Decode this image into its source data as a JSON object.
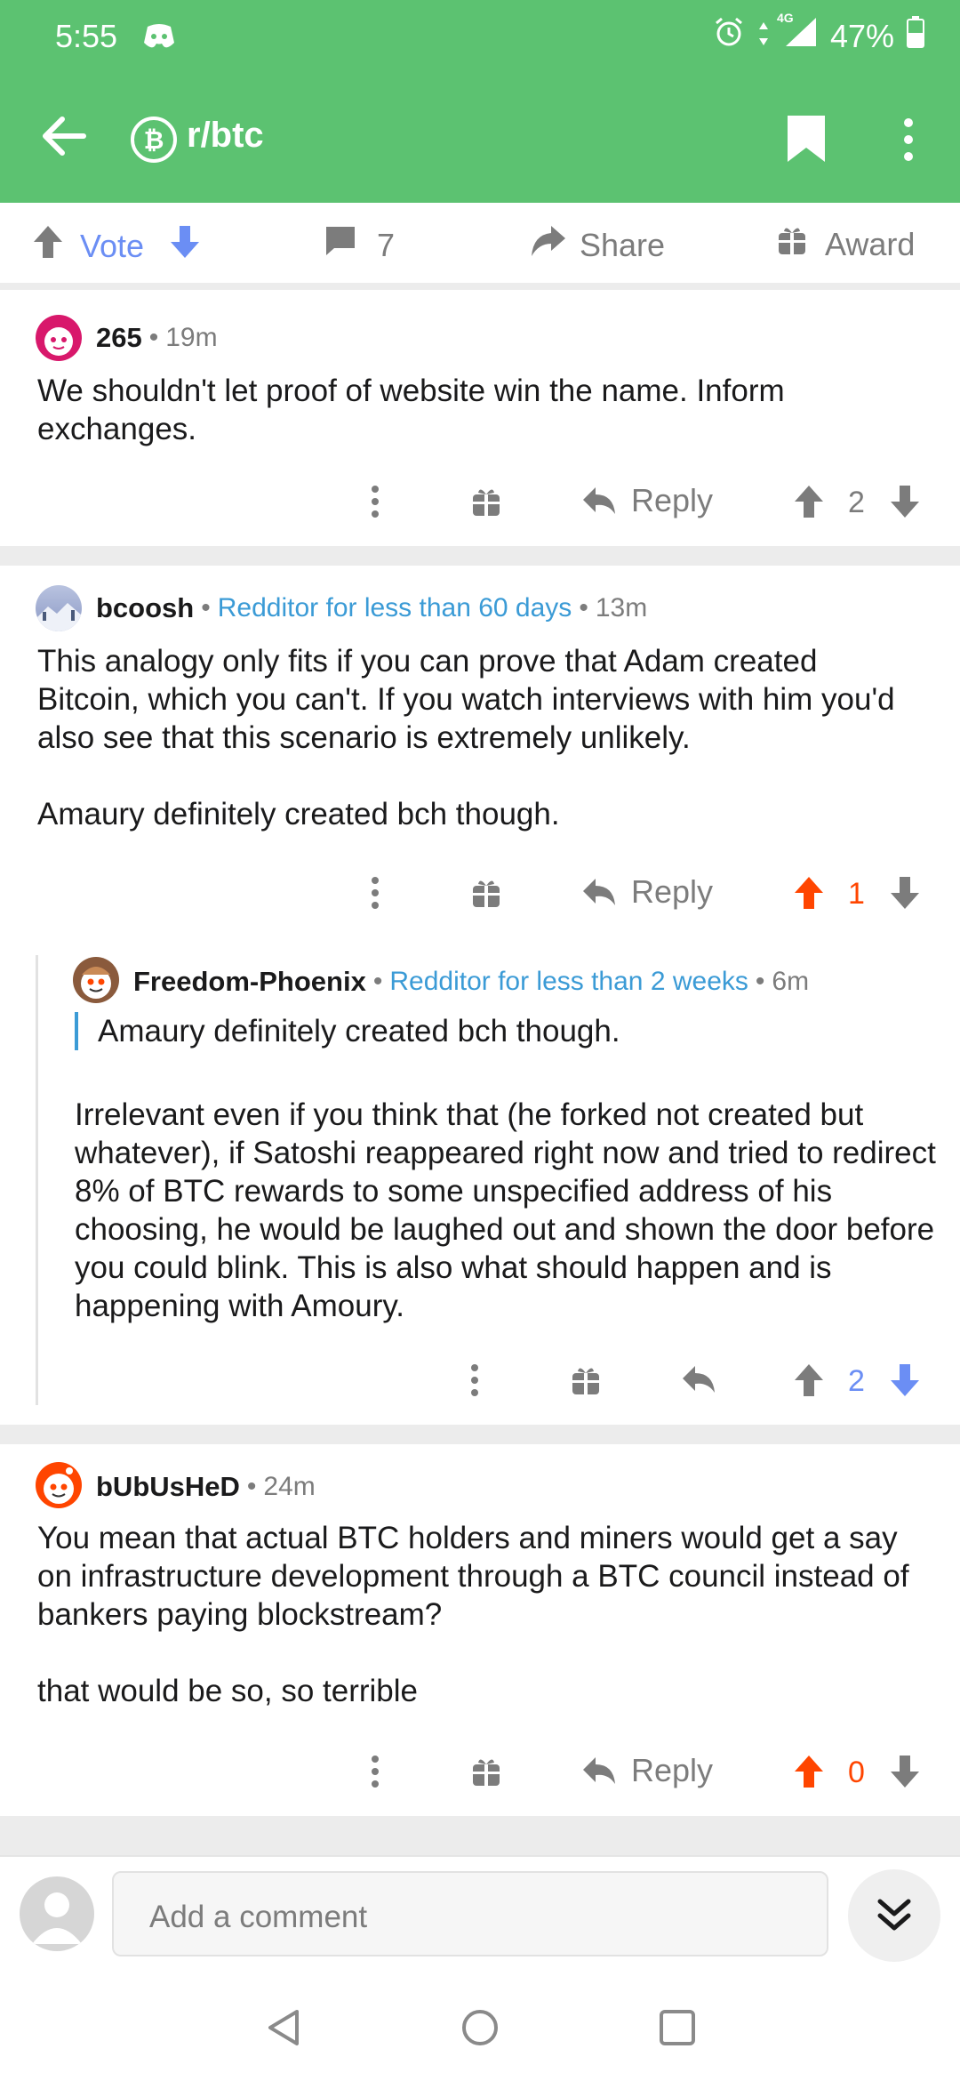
{
  "status_bar": {
    "time": "5:55",
    "network": "4G",
    "battery": "47%"
  },
  "header": {
    "subreddit": "r/btc",
    "accent": "#5cc271"
  },
  "post_actions": {
    "vote_label": "Vote",
    "comments_count": "7",
    "share_label": "Share",
    "award_label": "Award"
  },
  "comments": [
    {
      "username": "265",
      "time": "19m",
      "paragraphs": [
        "We shouldn't let proof of website win the name. Inform exchanges."
      ],
      "reply_label": "Reply",
      "score": "2",
      "vote_state": "none"
    },
    {
      "username": "bcoosh",
      "flair": "Redditor for less than 60 days",
      "time": "13m",
      "paragraphs": [
        "This analogy only fits if you can prove that Adam created Bitcoin, which you can't.  If you watch interviews with him you'd also see that this scenario is extremely unlikely.",
        "Amaury definitely created bch though."
      ],
      "reply_label": "Reply",
      "score": "1",
      "vote_state": "up"
    },
    {
      "username": "Freedom-Phoenix",
      "flair": "Redditor for less than 2 weeks",
      "time": "6m",
      "quote": "Amaury definitely created bch though.",
      "paragraphs": [
        "Irrelevant even if you think that (he forked not created but whatever), if Satoshi reappeared right now and tried to redirect 8% of BTC rewards to some unspecified address of his choosing, he would be laughed out and shown the door before you could blink. This is also what should happen and is happening with Amoury."
      ],
      "score": "2",
      "vote_state": "down"
    },
    {
      "username": "bUbUsHeD",
      "time": "24m",
      "paragraphs": [
        "You mean that actual BTC holders and miners would get a say on infrastructure development through a BTC council instead of bankers paying blockstream?",
        "that would be so, so terrible"
      ],
      "reply_label": "Reply",
      "score": "0",
      "vote_state": "up"
    }
  ],
  "composer": {
    "placeholder": "Add a comment"
  },
  "colors": {
    "upvote": "#ff4500",
    "downvote": "#6b8ef4",
    "flair": "#3b9bd6"
  }
}
